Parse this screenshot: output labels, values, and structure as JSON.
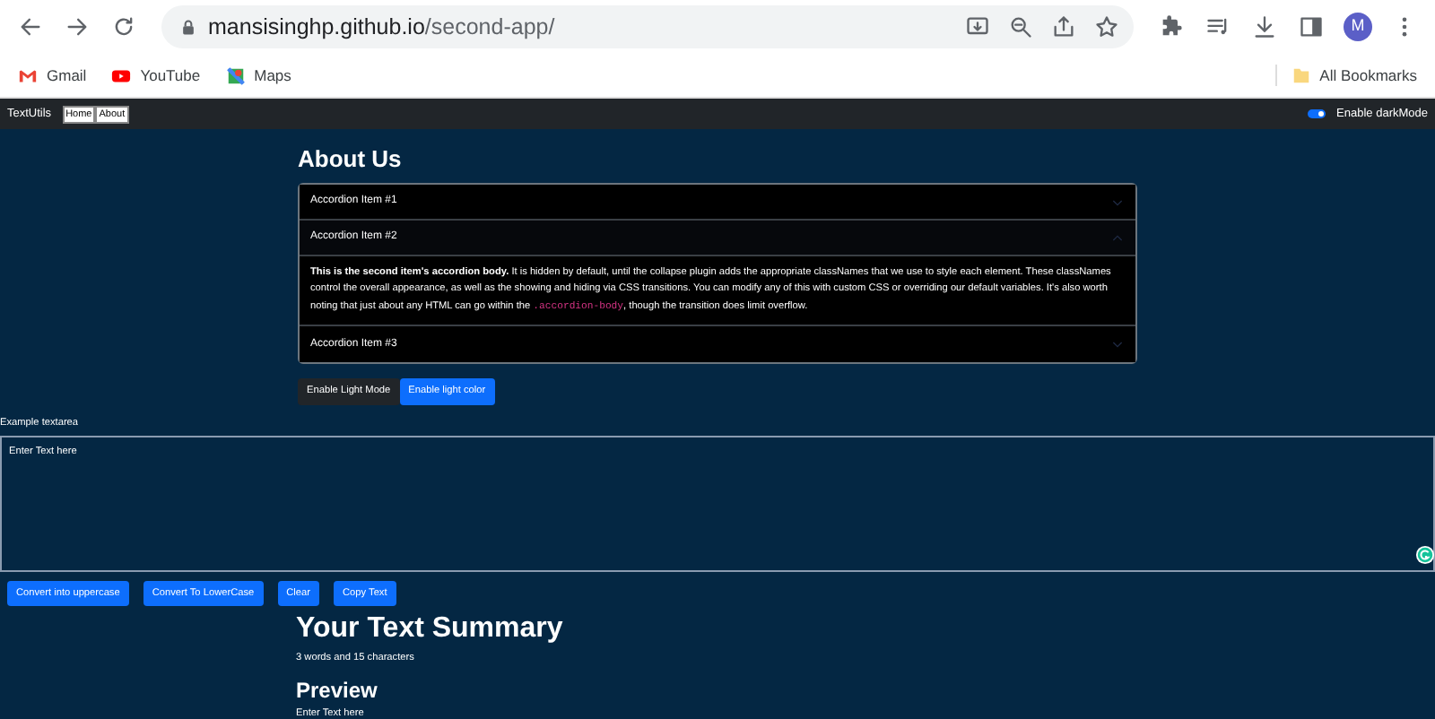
{
  "browser": {
    "url_host": "mansisinghp.github.io",
    "url_path": "/second-app/",
    "profile_initial": "M",
    "bookmarks": [
      {
        "label": "Gmail",
        "kind": "gmail"
      },
      {
        "label": "YouTube",
        "kind": "youtube"
      },
      {
        "label": "Maps",
        "kind": "maps"
      }
    ],
    "all_bookmarks": "All Bookmarks"
  },
  "navbar": {
    "brand": "TextUtils",
    "links": [
      {
        "label": "Home"
      },
      {
        "label": "About"
      }
    ],
    "dark_mode": {
      "label": "Enable darkMode",
      "on": true
    }
  },
  "about": {
    "title": "About Us",
    "accordion": [
      {
        "title": "Accordion Item #1",
        "expanded": false
      },
      {
        "title": "Accordion Item #2",
        "expanded": true,
        "body": {
          "text_before": "**This is the second item's accordion body.** It is hidden by default, until the collapse plugin adds the appropriate classNames that we use to style each element. These classNames control the overall appearance, as well as the showing and hiding via CSS transitions. You can modify any of this with custom CSS or overriding our default variables. It's also worth noting that just about any HTML can go within the",
          "code": ".accordion-body",
          "text_after": ", though the transition does limit overflow."
        }
      },
      {
        "title": "Accordion Item #3",
        "expanded": false
      }
    ],
    "buttons": [
      {
        "label": "Enable Light Mode",
        "kind": "dark"
      },
      {
        "label": "Enable light color",
        "kind": "primary"
      }
    ]
  },
  "form": {
    "label": "Example textarea",
    "value": "Enter Text here",
    "buttons": [
      {
        "label": "Convert into uppercase"
      },
      {
        "label": "Convert To LowerCase"
      },
      {
        "label": "Clear"
      },
      {
        "label": "Copy Text"
      }
    ]
  },
  "summary": {
    "title": "Your Text Summary",
    "stats": "3 words and 15 characters",
    "preview_title": "Preview",
    "preview": "Enter Text here"
  }
}
